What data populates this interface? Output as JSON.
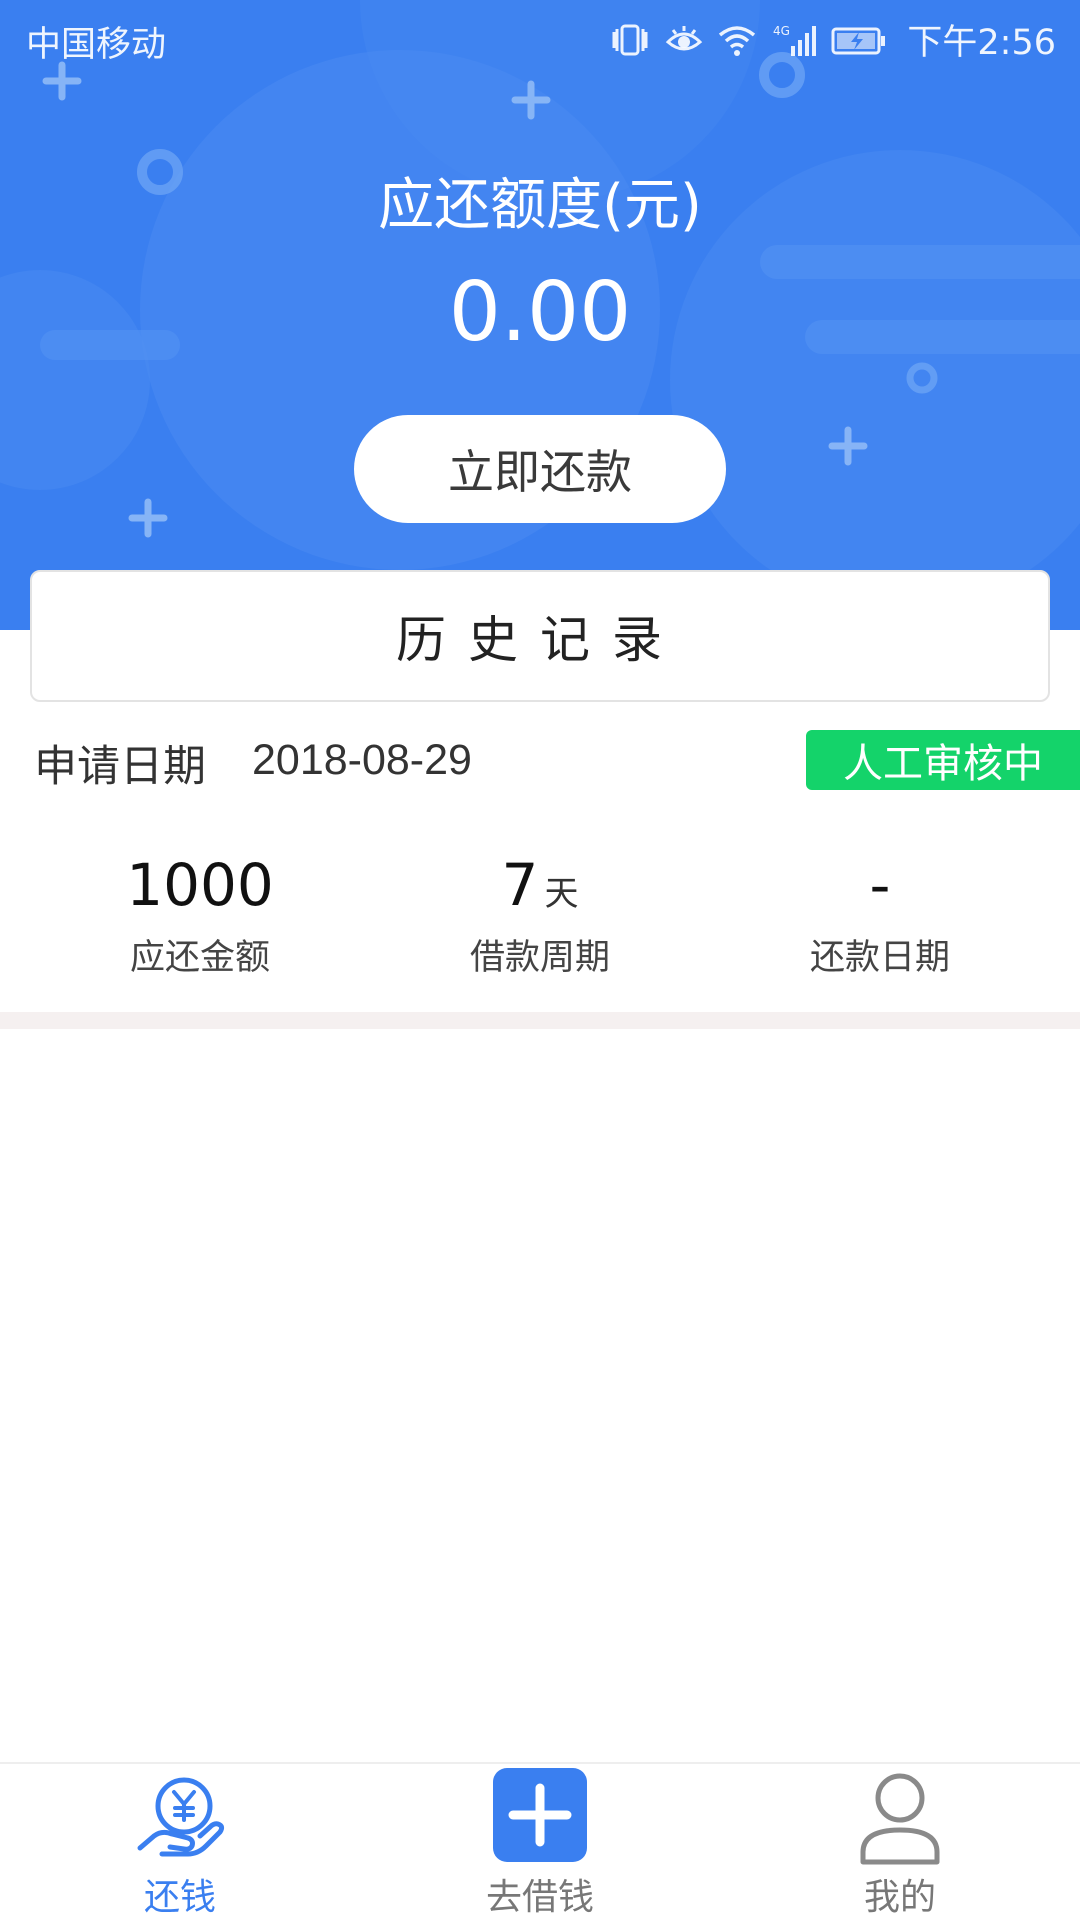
{
  "colors": {
    "primary": "#3a7ff0",
    "badge_green": "#14d36a"
  },
  "status_bar": {
    "carrier": "中国移动",
    "network": "4G",
    "time": "下午2:56",
    "icons": [
      "vibrate-icon",
      "eye-comfort-icon",
      "wifi-icon",
      "signal-icon",
      "battery-icon"
    ]
  },
  "header": {
    "amount_label": "应还额度(元)",
    "amount_value": "0.00",
    "repay_button": "立即还款"
  },
  "history": {
    "title": "历史记录"
  },
  "record": {
    "date_label": "申请日期",
    "date_value": "2018-08-29",
    "status": "人工审核中",
    "stats": [
      {
        "value": "1000",
        "unit": "",
        "label": "应还金额"
      },
      {
        "value": "7",
        "unit": "天",
        "label": "借款周期"
      },
      {
        "value": "-",
        "unit": "",
        "label": "还款日期"
      }
    ]
  },
  "bottom_nav": [
    {
      "label": "还钱",
      "icon": "repay-hand-yen-icon",
      "active": true
    },
    {
      "label": "去借钱",
      "icon": "plus-square-icon",
      "active": false
    },
    {
      "label": "我的",
      "icon": "user-profile-icon",
      "active": false
    }
  ]
}
